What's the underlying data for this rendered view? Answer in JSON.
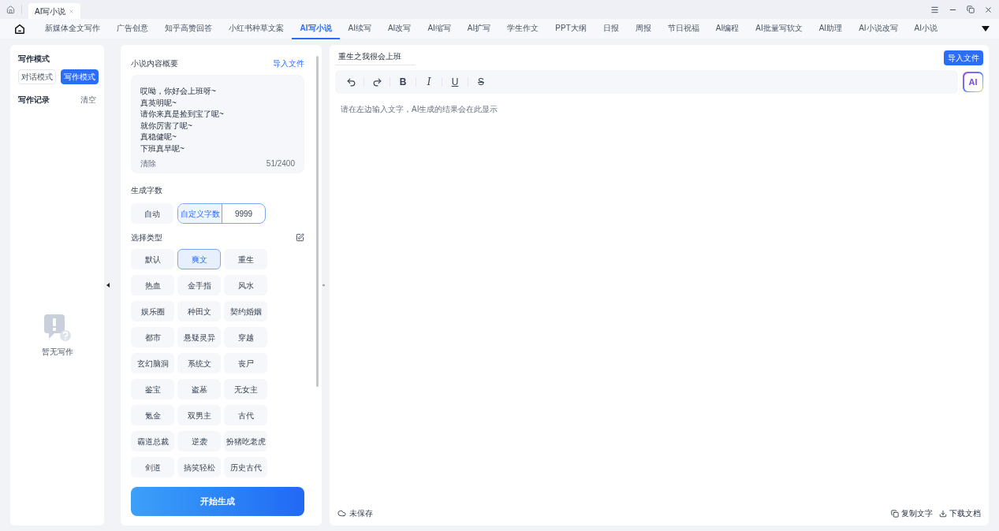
{
  "window": {
    "tab_title": "AI写小说"
  },
  "nav_tabs": [
    {
      "label": "新媒体全文写作",
      "selected": false
    },
    {
      "label": "广告创意",
      "selected": false
    },
    {
      "label": "知乎高赞回答",
      "selected": false
    },
    {
      "label": "小红书种草文案",
      "selected": false
    },
    {
      "label": "AI写小说",
      "selected": true
    },
    {
      "label": "AI续写",
      "selected": false
    },
    {
      "label": "AI改写",
      "selected": false
    },
    {
      "label": "AI缩写",
      "selected": false
    },
    {
      "label": "AI扩写",
      "selected": false
    },
    {
      "label": "学生作文",
      "selected": false
    },
    {
      "label": "PPT大纲",
      "selected": false
    },
    {
      "label": "日报",
      "selected": false
    },
    {
      "label": "周报",
      "selected": false
    },
    {
      "label": "节日祝福",
      "selected": false
    },
    {
      "label": "AI编程",
      "selected": false
    },
    {
      "label": "AI批量写软文",
      "selected": false
    },
    {
      "label": "AI助理",
      "selected": false
    },
    {
      "label": "AI小说改写",
      "selected": false
    },
    {
      "label": "AI小说",
      "selected": false
    }
  ],
  "sidebar": {
    "mode_label": "写作模式",
    "modes": [
      {
        "label": "对话模式",
        "selected": false
      },
      {
        "label": "写作模式",
        "selected": true
      }
    ],
    "records_label": "写作记录",
    "clear": "清空",
    "empty_text": "暂无写作"
  },
  "form": {
    "summary_label": "小说内容概要",
    "import_link": "导入文件",
    "summary_value": "哎呦，你好会上班呀~\n真英明呢~\n请你来真是捡到宝了呢~\n就你厉害了呢~\n真稳健呢~\n下班真早呢~",
    "clear": "清除",
    "count": "51/2400",
    "length_label": "生成字数",
    "length_options": [
      {
        "label": "自动",
        "selected": false
      },
      {
        "label": "自定义字数",
        "selected": true
      }
    ],
    "custom_value": "9999",
    "type_label": "选择类型",
    "types": [
      {
        "label": "默认",
        "selected": false
      },
      {
        "label": "爽文",
        "selected": true
      },
      {
        "label": "重生",
        "selected": false
      },
      {
        "label": "热血",
        "selected": false
      },
      {
        "label": "金手指",
        "selected": false
      },
      {
        "label": "风水",
        "selected": false
      },
      {
        "label": "娱乐圈",
        "selected": false
      },
      {
        "label": "种田文",
        "selected": false
      },
      {
        "label": "契约婚姻",
        "selected": false
      },
      {
        "label": "都市",
        "selected": false
      },
      {
        "label": "悬疑灵异",
        "selected": false
      },
      {
        "label": "穿越",
        "selected": false
      },
      {
        "label": "玄幻脑洞",
        "selected": false
      },
      {
        "label": "系统文",
        "selected": false
      },
      {
        "label": "丧尸",
        "selected": false
      },
      {
        "label": "鉴宝",
        "selected": false
      },
      {
        "label": "盗墓",
        "selected": false
      },
      {
        "label": "无女主",
        "selected": false
      },
      {
        "label": "氪金",
        "selected": false
      },
      {
        "label": "双男主",
        "selected": false
      },
      {
        "label": "古代",
        "selected": false
      },
      {
        "label": "霸道总裁",
        "selected": false
      },
      {
        "label": "逆袭",
        "selected": false
      },
      {
        "label": "扮猪吃老虎",
        "selected": false
      },
      {
        "label": "剑道",
        "selected": false
      },
      {
        "label": "搞笑轻松",
        "selected": false
      },
      {
        "label": "历史古代",
        "selected": false
      }
    ],
    "start_button": "开始生成"
  },
  "editor": {
    "title_value": "重生之我很会上班",
    "import_button": "导入文件",
    "toolbar": [
      {
        "kind": "undo"
      },
      {
        "kind": "redo"
      },
      {
        "kind": "bold",
        "label": "B"
      },
      {
        "kind": "italic",
        "label": "I"
      },
      {
        "kind": "underline",
        "label": "U"
      },
      {
        "kind": "strike",
        "label": "S"
      }
    ],
    "ai_badge": "AI",
    "placeholder": "请在左边输入文字，AI生成的结果会在此显示",
    "save_status": "未保存",
    "actions": [
      {
        "kind": "copy",
        "label": "复制文字"
      },
      {
        "kind": "download",
        "label": "下载文档"
      }
    ]
  }
}
